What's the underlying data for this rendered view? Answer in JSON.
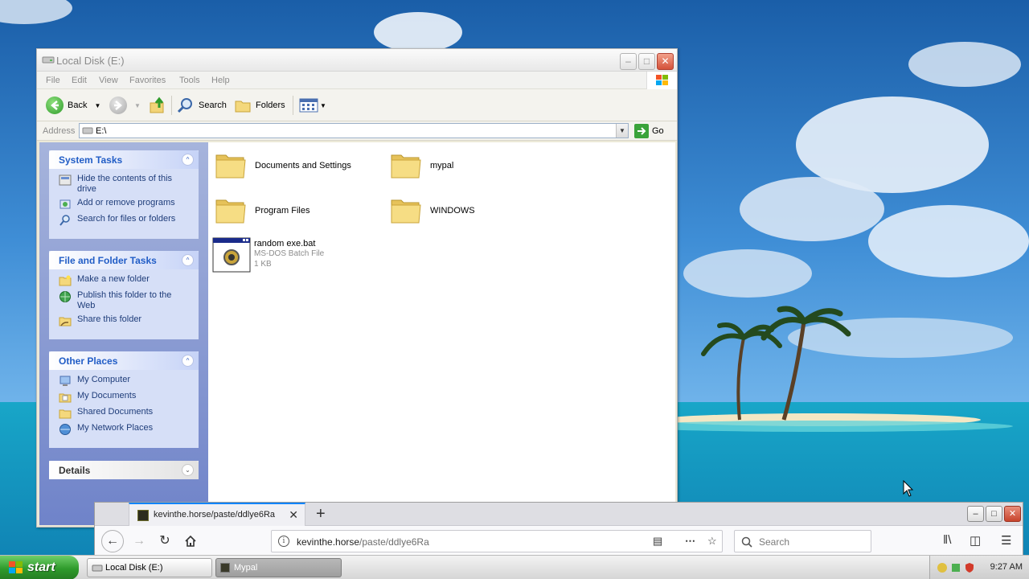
{
  "explorer": {
    "title": "Local Disk (E:)",
    "menu": [
      "File",
      "Edit",
      "View",
      "Favorites",
      "Tools",
      "Help"
    ],
    "toolbar": {
      "back_label": "Back",
      "search_label": "Search",
      "folders_label": "Folders"
    },
    "address": {
      "label": "Address",
      "value": "E:\\",
      "go_label": "Go"
    },
    "system_tasks": {
      "title": "System Tasks",
      "items": [
        "Hide the contents of this drive",
        "Add or remove programs",
        "Search for files or folders"
      ]
    },
    "file_folder_tasks": {
      "title": "File and Folder Tasks",
      "items": [
        "Make a new folder",
        "Publish this folder to the Web",
        "Share this folder"
      ]
    },
    "other_places": {
      "title": "Other Places",
      "items": [
        "My Computer",
        "My Documents",
        "Shared Documents",
        "My Network Places"
      ]
    },
    "details": {
      "title": "Details"
    },
    "files": [
      {
        "name": "Documents and Settings"
      },
      {
        "name": "mypal"
      },
      {
        "name": "Program Files"
      },
      {
        "name": "WINDOWS"
      },
      {
        "name": "random exe.bat",
        "type": "MS-DOS Batch File",
        "size": "1 KB"
      }
    ]
  },
  "firefox": {
    "tab_title": "kevinthe.horse/paste/ddlye6Ra",
    "url_host": "kevinthe.horse",
    "url_path": "/paste/ddlye6Ra",
    "search_placeholder": "Search"
  },
  "taskbar": {
    "start_label": "start",
    "buttons": [
      "Local Disk (E:)",
      "Mypal"
    ],
    "clock": "9:27 AM"
  },
  "colors": {
    "task_link": "#1f3d7a",
    "pane_header": "#215dc6",
    "start_green": "#2e9a2b"
  }
}
